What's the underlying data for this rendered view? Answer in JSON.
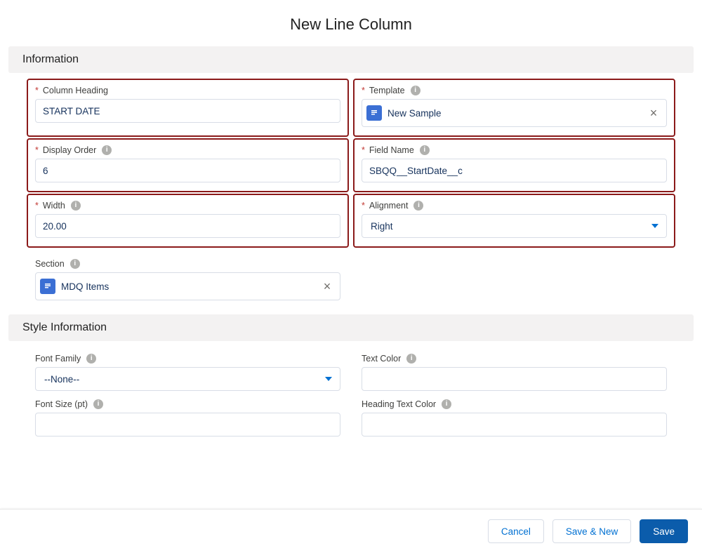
{
  "title": "New Line Column",
  "sections": {
    "information": "Information",
    "style": "Style Information"
  },
  "fields": {
    "columnHeading": {
      "label": "Column Heading",
      "value": "START DATE",
      "required": true
    },
    "template": {
      "label": "Template",
      "value": "New Sample",
      "required": true
    },
    "displayOrder": {
      "label": "Display Order",
      "value": "6",
      "required": true
    },
    "fieldName": {
      "label": "Field Name",
      "value": "SBQQ__StartDate__c",
      "required": true
    },
    "width": {
      "label": "Width",
      "value": "20.00",
      "required": true
    },
    "alignment": {
      "label": "Alignment",
      "value": "Right",
      "required": true
    },
    "section": {
      "label": "Section",
      "value": "MDQ Items",
      "required": false
    },
    "fontFamily": {
      "label": "Font Family",
      "value": "--None--"
    },
    "textColor": {
      "label": "Text Color",
      "value": ""
    },
    "fontSize": {
      "label": "Font Size (pt)",
      "value": ""
    },
    "headingTextColor": {
      "label": "Heading Text Color",
      "value": ""
    }
  },
  "buttons": {
    "cancel": "Cancel",
    "saveNew": "Save & New",
    "save": "Save"
  }
}
